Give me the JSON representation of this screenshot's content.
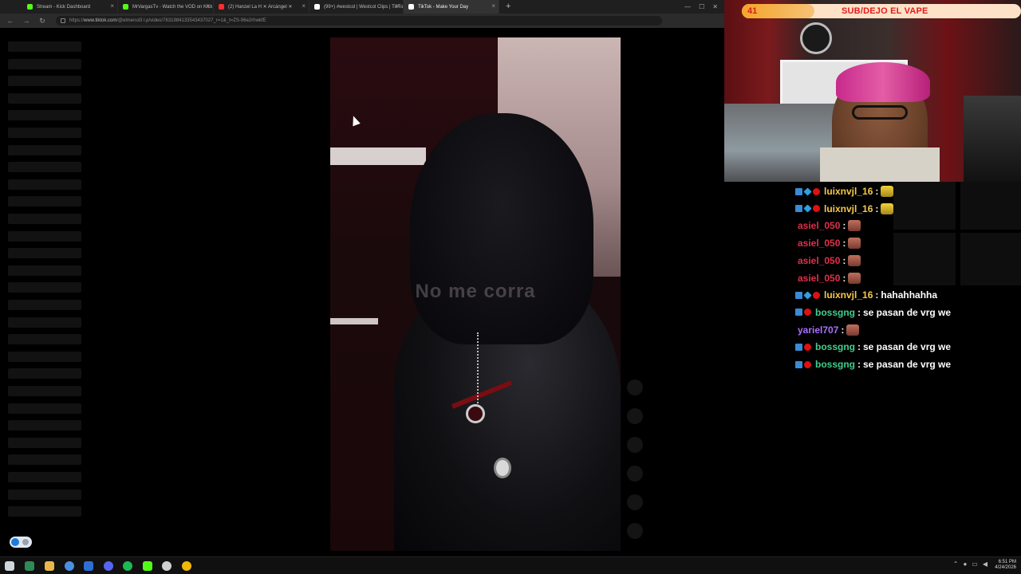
{
  "browser": {
    "tabs": [
      {
        "label": "Stream - Kick Dashboard",
        "favicon_color": "#53fc18",
        "active": false
      },
      {
        "label": "MrVargasTv - Watch the VOD on Kick",
        "favicon_color": "#53fc18",
        "active": false
      },
      {
        "label": "(2) Hanzel La H ✕ Arcángel ✕",
        "favicon_color": "#ff2d2d",
        "active": false
      },
      {
        "label": "(99+) #westcol | Westcol Clips | TikTok",
        "favicon_color": "#ffffff",
        "active": false
      },
      {
        "label": "TikTok - Make Your Day",
        "favicon_color": "#ffffff",
        "active": true
      }
    ],
    "new_tab_symbol": "+",
    "url": {
      "scheme": "https://",
      "host": "www.tiktok.com",
      "path": "/@elmenol3 l.p/video/7631984133543437027_r=1&_t=ZS-96e2rhwkfE"
    }
  },
  "video": {
    "caption_text": "No me corra"
  },
  "stream_overlay": {
    "goal": {
      "count": "41",
      "label": "SUB/DEJO EL VAPE",
      "progress": 0.26
    }
  },
  "chat": {
    "messages": [
      {
        "user": "luixnvjl_16",
        "color": "#f5c94a",
        "badges": [
          "blue",
          "cube",
          "red"
        ],
        "text": "",
        "emote": "yellow"
      },
      {
        "user": "luixnvjl_16",
        "color": "#f5c94a",
        "badges": [
          "blue",
          "cube",
          "red"
        ],
        "text": "",
        "emote": "yellow"
      },
      {
        "user": "asiel_050",
        "color": "#e0304a",
        "badges": [],
        "text": "",
        "emote": "face"
      },
      {
        "user": "asiel_050",
        "color": "#e0304a",
        "badges": [],
        "text": "",
        "emote": "face"
      },
      {
        "user": "asiel_050",
        "color": "#e0304a",
        "badges": [],
        "text": "",
        "emote": "face"
      },
      {
        "user": "asiel_050",
        "color": "#e0304a",
        "badges": [],
        "text": "",
        "emote": "face"
      },
      {
        "user": "luixnvjl_16",
        "color": "#f5c94a",
        "badges": [
          "blue",
          "cube",
          "red"
        ],
        "text": "hahahhahha",
        "emote": ""
      },
      {
        "user": "bossgng",
        "color": "#3fcf8e",
        "badges": [
          "blue",
          "red"
        ],
        "text": "se pasan de vrg we",
        "emote": ""
      },
      {
        "user": "yariel707",
        "color": "#a970ff",
        "badges": [],
        "text": "",
        "emote": "face"
      },
      {
        "user": "bossgng",
        "color": "#3fcf8e",
        "badges": [
          "blue",
          "red"
        ],
        "text": "se pasan de vrg we",
        "emote": ""
      },
      {
        "user": "bossgng",
        "color": "#3fcf8e",
        "badges": [
          "blue",
          "red"
        ],
        "text": "se pasan de vrg we",
        "emote": ""
      }
    ]
  },
  "taskbar": {
    "apps": [
      {
        "name": "start-icon",
        "color": "#cfd6dd"
      },
      {
        "name": "terminal-icon",
        "color": "#2e8b57"
      },
      {
        "name": "folder-icon",
        "color": "#e8b84a"
      },
      {
        "name": "chrome-icon",
        "color": "#4a90e2"
      },
      {
        "name": "app-blue-icon",
        "color": "#2d6fd6"
      },
      {
        "name": "discord-icon",
        "color": "#5865f2"
      },
      {
        "name": "spotify-icon",
        "color": "#1db954"
      },
      {
        "name": "kick-icon",
        "color": "#53fc18"
      },
      {
        "name": "obs-icon",
        "color": "#d0d0d0"
      },
      {
        "name": "chrome-canary-icon",
        "color": "#f2b705"
      }
    ],
    "clock_time": "6:51 PM",
    "clock_date": "4/24/2026"
  }
}
